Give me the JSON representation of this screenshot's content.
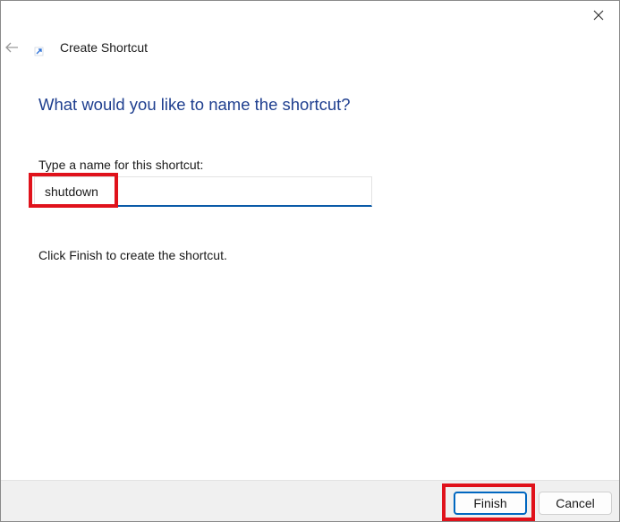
{
  "window": {
    "title": "Create Shortcut"
  },
  "controls": {
    "close_icon": "close-icon",
    "back_icon": "back-arrow-icon",
    "wizard_icon": "shortcut-arrow-icon"
  },
  "page": {
    "heading": "What would you like to name the shortcut?",
    "field_label": "Type a name for this shortcut:",
    "name_value": "shutdown",
    "hint": "Click Finish to create the shortcut."
  },
  "footer": {
    "finish_label": "Finish",
    "cancel_label": "Cancel"
  },
  "colors": {
    "heading": "#1f3f8f",
    "accent": "#0067c0",
    "annotation_highlight": "#e0121b",
    "footer_bg": "#f0f0f0"
  }
}
